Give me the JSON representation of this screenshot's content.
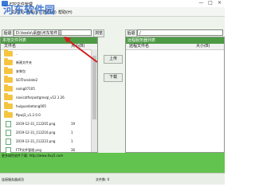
{
  "window": {
    "title": "FTP文件管理",
    "watermark": "河东软件园",
    "controls": [
      "—",
      "□",
      "×"
    ]
  },
  "menu": [
    "文件(F)",
    "查看(V)",
    "选项(O)",
    "帮助(H)"
  ],
  "left": {
    "back_label": "后退",
    "path_value": "D:\\tools\\桌面\\河东软件园",
    "browse_label": "浏览",
    "panel_title": "本地文件列表",
    "col_name": "文件名",
    "col_size": "大小(B)",
    "items": [
      {
        "name": "..",
        "size": "",
        "kind": "up"
      },
      {
        "name": "新建文件夹",
        "size": "",
        "kind": "folder"
      },
      {
        "name": "安装包",
        "size": "",
        "kind": "folder"
      },
      {
        "name": "SCITranslate2",
        "size": "",
        "kind": "folder"
      },
      {
        "name": "noing07105",
        "size": "",
        "kind": "folder"
      },
      {
        "name": "navicatforpostgresql_v12.1.26",
        "size": "",
        "kind": "folder"
      },
      {
        "name": "huiguanbetang005",
        "size": "",
        "kind": "folder"
      },
      {
        "name": "ftpwj3_v1.2.0.0",
        "size": "",
        "kind": "folder"
      },
      {
        "name": "2019-12-31_112205.png",
        "size": "19",
        "kind": "file"
      },
      {
        "name": "2019-12-31_112216.png",
        "size": "1",
        "kind": "file"
      },
      {
        "name": "2019-12-31_112223.png",
        "size": "1",
        "kind": "file"
      },
      {
        "name": "FTP文件管理.png",
        "size": "36",
        "kind": "file"
      }
    ]
  },
  "middle": {
    "upload_label": "上传",
    "download_label": "下载"
  },
  "right": {
    "back_label": "后退",
    "path_value": "/",
    "panel_title": "远程服务器列表",
    "col_name": "远程文件名",
    "col_size": "大小(B)"
  },
  "message": "更多绿色软件下载: http://www.0xy5.com",
  "status": {
    "left": "连接服务器成功",
    "middle": "文件数: 0"
  }
}
